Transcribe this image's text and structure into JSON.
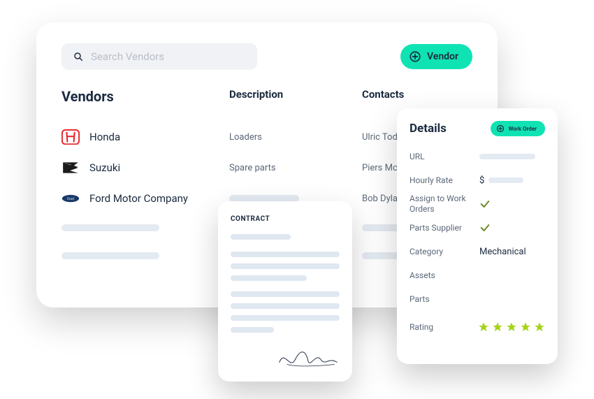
{
  "search": {
    "placeholder": "Search Vendors"
  },
  "addVendorButton": "Vendor",
  "columns": {
    "vendors": "Vendors",
    "description": "Description",
    "contacts": "Contacts"
  },
  "rows": [
    {
      "name": "Honda",
      "description": "Loaders",
      "contact": "Ulric Todd"
    },
    {
      "name": "Suzuki",
      "description": "Spare parts",
      "contact": "Piers Mcconnell"
    },
    {
      "name": "Ford Motor Company",
      "description": "",
      "contact": "Bob Dylan"
    }
  ],
  "contract": {
    "title": "CONTRACT"
  },
  "details": {
    "title": "Details",
    "workOrderButton": "Work Order",
    "labels": {
      "url": "URL",
      "hourly": "Hourly Rate",
      "assign": "Assign to Work Orders",
      "supplier": "Parts Supplier",
      "category": "Category",
      "assets": "Assets",
      "parts": "Parts",
      "rating": "Rating"
    },
    "values": {
      "hourlyPrefix": "$",
      "assign": true,
      "supplier": true,
      "category": "Mechanical",
      "rating": 5
    }
  }
}
